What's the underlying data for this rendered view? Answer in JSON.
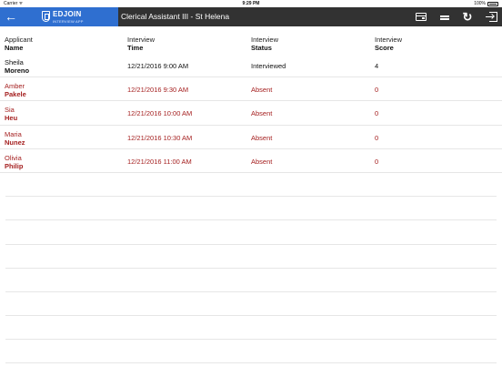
{
  "status_bar": {
    "carrier": "Carrier ᯤ",
    "time": "9:29 PM",
    "battery": "100%"
  },
  "nav": {
    "brand_title": "EDJOIN",
    "brand_subtitle": "INTERVIEW APP",
    "page_title": "Clerical Assistant III - St Helena",
    "icons": [
      "back-arrow-icon",
      "calculator-icon",
      "menu-icon",
      "refresh-icon",
      "logout-icon"
    ],
    "colors": {
      "brand": "#2f6fd0",
      "bar": "#323232",
      "absent": "#a52020"
    }
  },
  "table": {
    "headers": [
      {
        "line1": "Applicant",
        "line2": "Name"
      },
      {
        "line1": "Interview",
        "line2": "Time"
      },
      {
        "line1": "Interview",
        "line2": "Status"
      },
      {
        "line1": "Interview",
        "line2": "Score"
      }
    ],
    "rows": [
      {
        "first": "Sheila",
        "last": "Moreno",
        "time": "12/21/2016 9:00 AM",
        "status": "Interviewed",
        "score": "4"
      },
      {
        "first": "Amber",
        "last": "Pakele",
        "time": "12/21/2016 9:30 AM",
        "status": "Absent",
        "score": "0"
      },
      {
        "first": "Sia",
        "last": "Heu",
        "time": "12/21/2016 10:00 AM",
        "status": "Absent",
        "score": "0"
      },
      {
        "first": "Maria",
        "last": "Nunez",
        "time": "12/21/2016 10:30 AM",
        "status": "Absent",
        "score": "0"
      },
      {
        "first": "Olivia",
        "last": "Philip",
        "time": "12/21/2016 11:00 AM",
        "status": "Absent",
        "score": "0"
      }
    ]
  }
}
